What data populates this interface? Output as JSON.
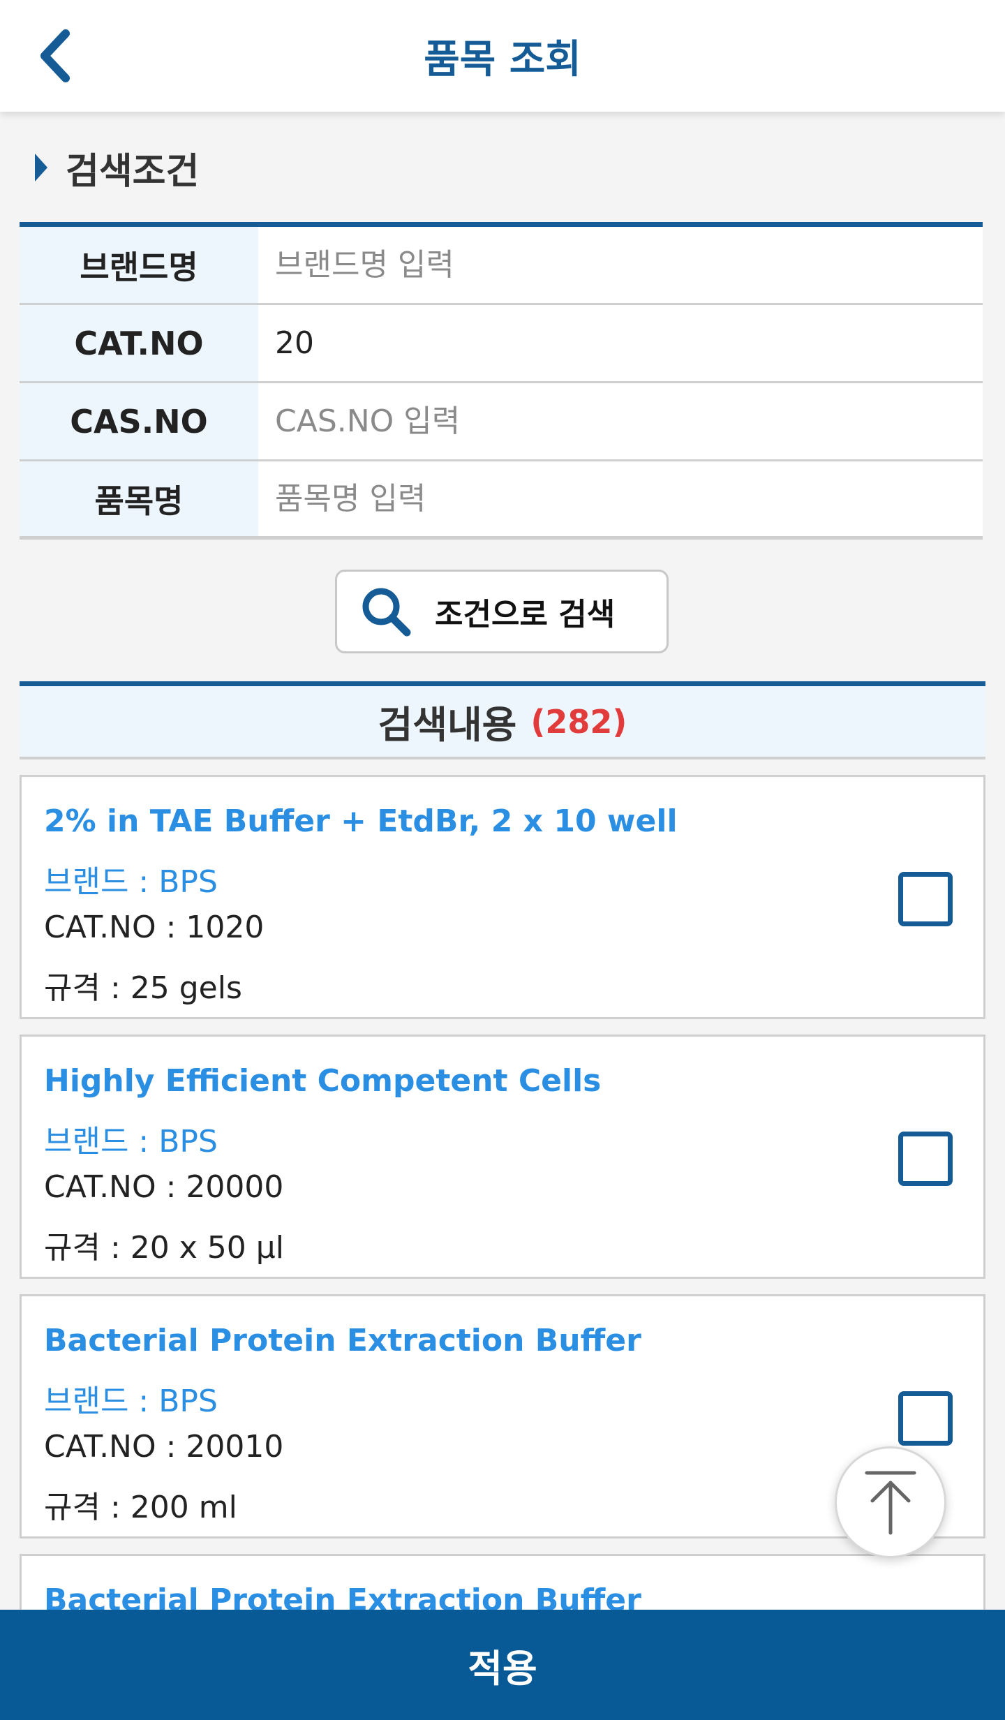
{
  "header": {
    "title": "품목 조회"
  },
  "search": {
    "section_title": "검색조건",
    "fields": [
      {
        "label": "브랜드명",
        "value": "",
        "placeholder": "브랜드명 입력"
      },
      {
        "label": "CAT.NO",
        "value": "20",
        "placeholder": ""
      },
      {
        "label": "CAS.NO",
        "value": "",
        "placeholder": "CAS.NO 입력"
      },
      {
        "label": "품목명",
        "value": "",
        "placeholder": "품목명 입력"
      }
    ],
    "button_label": "조건으로 검색"
  },
  "results": {
    "title": "검색내용",
    "count": "(282)",
    "items": [
      {
        "name": "2% in TAE Buffer + EtdBr, 2 x 10 well",
        "brand": "브랜드 : BPS",
        "cat_no": "CAT.NO : 1020",
        "spec": "규격 : 25 gels",
        "checked": false
      },
      {
        "name": "Highly Efficient Competent Cells",
        "brand": "브랜드 : BPS",
        "cat_no": "CAT.NO : 20000",
        "spec": "규격 : 20 x 50 μl",
        "checked": false
      },
      {
        "name": "Bacterial Protein Extraction Buffer",
        "brand": "브랜드 : BPS",
        "cat_no": "CAT.NO : 20010",
        "spec": "규격 : 200 ml",
        "checked": false
      },
      {
        "name": "Bacterial Protein Extraction Buffer",
        "brand": "",
        "cat_no": "",
        "spec": "",
        "checked": false
      }
    ]
  },
  "footer": {
    "apply_label": "적용"
  },
  "icons": {
    "back": "chevron-left-icon",
    "search": "search-icon",
    "scroll_top": "arrow-up-to-top-icon",
    "section": "triangle-right-icon"
  },
  "colors": {
    "brand_blue": "#155b96",
    "link_blue": "#2a8ee3",
    "count_red": "#e23b3b",
    "apply_bar": "#085a96"
  }
}
